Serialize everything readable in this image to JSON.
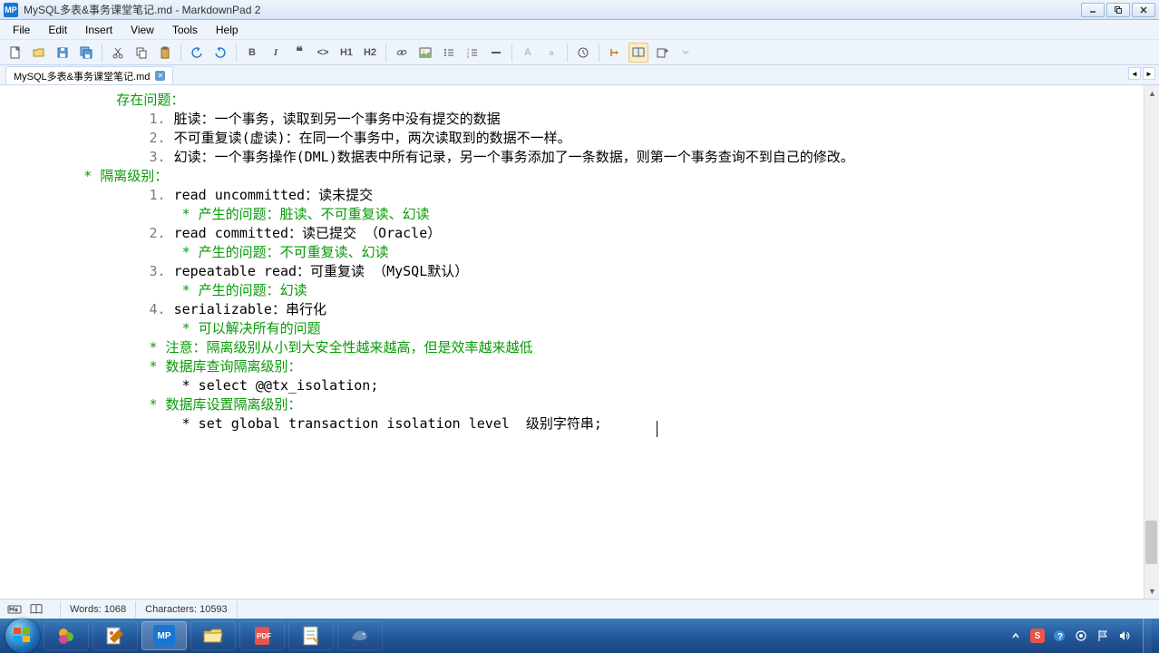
{
  "window": {
    "title": "MySQL多表&事务课堂笔记.md - MarkdownPad 2",
    "app_icon_text": "MP"
  },
  "menu": {
    "items": [
      "File",
      "Edit",
      "Insert",
      "View",
      "Tools",
      "Help"
    ]
  },
  "toolbar": {
    "h1": "H1",
    "h2": "H2",
    "bold": "B",
    "uppercase_a": "A",
    "lowercase_a": "a"
  },
  "tabs": {
    "active": "MySQL多表&事务课堂笔记.md"
  },
  "editor": {
    "lines": [
      {
        "indent": 3,
        "prefix": "",
        "text": "存在问题：",
        "cls": "comment"
      },
      {
        "indent": 4,
        "prefix": "1. ",
        "text": "脏读：一个事务，读取到另一个事务中没有提交的数据"
      },
      {
        "indent": 4,
        "prefix": "2. ",
        "text": "不可重复读(虚读)：在同一个事务中，两次读取到的数据不一样。"
      },
      {
        "indent": 4,
        "prefix": "3. ",
        "text": "幻读：一个事务操作(DML)数据表中所有记录，另一个事务添加了一条数据，则第一个事务查询不到自己的修改。"
      },
      {
        "indent": 2,
        "prefix": "* ",
        "text": "隔离级别：",
        "cls": "comment"
      },
      {
        "indent": 4,
        "prefix": "1. ",
        "text": "read uncommitted：读未提交"
      },
      {
        "indent": 5,
        "prefix": "* ",
        "text": "产生的问题：脏读、不可重复读、幻读",
        "cls": "comment"
      },
      {
        "indent": 4,
        "prefix": "2. ",
        "text": "read committed：读已提交 （Oracle）"
      },
      {
        "indent": 5,
        "prefix": "* ",
        "text": "产生的问题：不可重复读、幻读",
        "cls": "comment"
      },
      {
        "indent": 4,
        "prefix": "3. ",
        "text": "repeatable read：可重复读 （MySQL默认）"
      },
      {
        "indent": 5,
        "prefix": "* ",
        "text": "产生的问题：幻读",
        "cls": "comment"
      },
      {
        "indent": 4,
        "prefix": "4. ",
        "text": "serializable：串行化"
      },
      {
        "indent": 5,
        "prefix": "* ",
        "text": "可以解决所有的问题",
        "cls": "comment"
      },
      {
        "indent": 0,
        "prefix": "",
        "text": ""
      },
      {
        "indent": 4,
        "prefix": "* ",
        "text": "注意：隔离级别从小到大安全性越来越高，但是效率越来越低",
        "cls": "comment"
      },
      {
        "indent": 4,
        "prefix": "* ",
        "text": "数据库查询隔离级别：",
        "cls": "comment"
      },
      {
        "indent": 5,
        "prefix": "* ",
        "text": "select @@tx_isolation;"
      },
      {
        "indent": 4,
        "prefix": "* ",
        "text": "数据库设置隔离级别：",
        "cls": "comment"
      },
      {
        "indent": 5,
        "prefix": "* ",
        "text": "set global transaction isolation level  级别字符串;"
      }
    ]
  },
  "statusbar": {
    "words_label": "Words: 1068",
    "chars_label": "Characters: 10593"
  },
  "taskbar": {
    "tray_lang": "S"
  }
}
